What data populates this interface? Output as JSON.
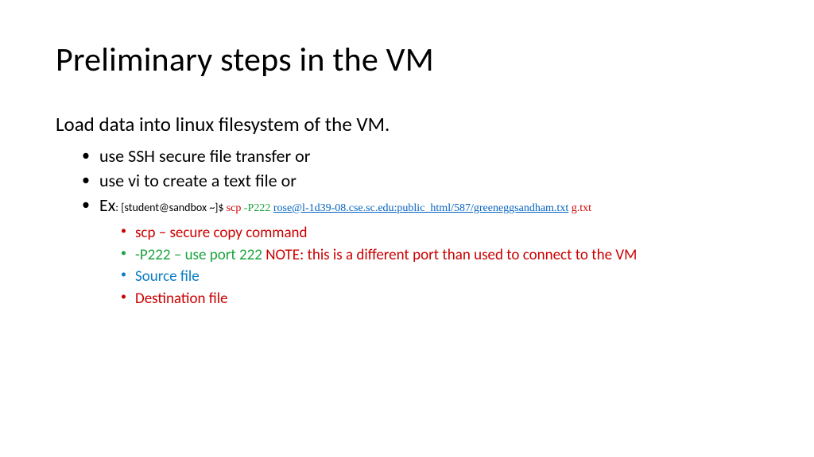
{
  "title": "Preliminary steps in the VM",
  "intro": "Load data into linux filesystem of the VM.",
  "bullets": {
    "b1": "use SSH secure file transfer or",
    "b2": "use vi to create a text file or",
    "ex": {
      "label": "Ex",
      "prompt": ": [student@sandbox ~]$ ",
      "scp": "scp ",
      "port": "-P222 ",
      "url": "rose@l-1d39-08.cse.sc.edu:public_html/587/greeneggsandham.txt",
      "dest": " g.txt"
    }
  },
  "sub": {
    "s1": "scp – secure copy command",
    "s2a": "-P222 – use port 222 ",
    "s2b": "NOTE: this is a different port than used to connect to the VM",
    "s3": "Source file",
    "s4": "Destination file"
  }
}
